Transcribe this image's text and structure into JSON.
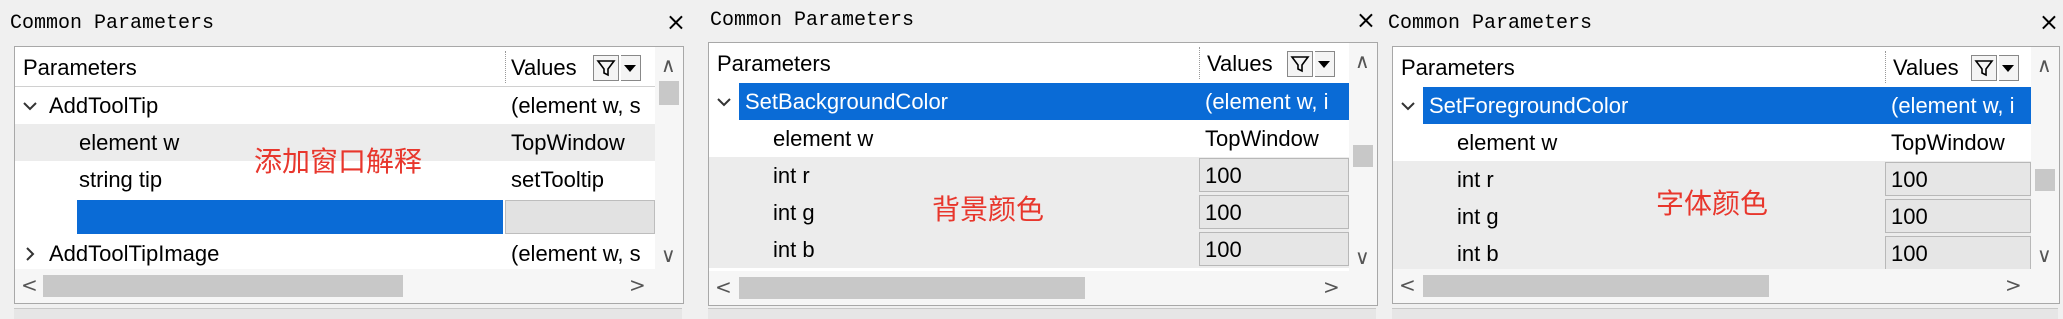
{
  "panels": [
    {
      "title": "Common Parameters",
      "close": "×",
      "headers": {
        "params": "Parameters",
        "values": "Values"
      },
      "rows": [
        {
          "name": "AddToolTip",
          "value": "(element w, s"
        },
        {
          "name": "element w",
          "value": "TopWindow"
        },
        {
          "name": "string tip",
          "value": "setTooltip"
        },
        {
          "name": "",
          "value": ""
        },
        {
          "name": "AddToolTipImage",
          "value": "(element w, s"
        }
      ],
      "note": "添加窗口解释"
    },
    {
      "title": "Common Parameters",
      "close": "×",
      "headers": {
        "params": "Parameters",
        "values": "Values"
      },
      "rows": [
        {
          "name": "SetBackgroundColor",
          "value": "(element w, i"
        },
        {
          "name": "element w",
          "value": "TopWindow"
        },
        {
          "name": "int r",
          "value": "100"
        },
        {
          "name": "int g",
          "value": "100"
        },
        {
          "name": "int b",
          "value": "100"
        }
      ],
      "note": "背景颜色"
    },
    {
      "title": "Common Parameters",
      "close": "×",
      "headers": {
        "params": "Parameters",
        "values": "Values"
      },
      "rows": [
        {
          "name": "SetForegroundColor",
          "value": "(element w, i"
        },
        {
          "name": "element w",
          "value": "TopWindow"
        },
        {
          "name": "int r",
          "value": "100"
        },
        {
          "name": "int g",
          "value": "100"
        },
        {
          "name": "int b",
          "value": "100"
        }
      ],
      "note": "字体颜色"
    }
  ],
  "icons": {
    "filter": "filter-icon",
    "dropdown": "dropdown-arrow-icon",
    "expand": "chevron-down-icon",
    "collapse": "chevron-right-icon"
  },
  "colors": {
    "selection": "#0a6bd6",
    "annotation": "#e8362c"
  }
}
